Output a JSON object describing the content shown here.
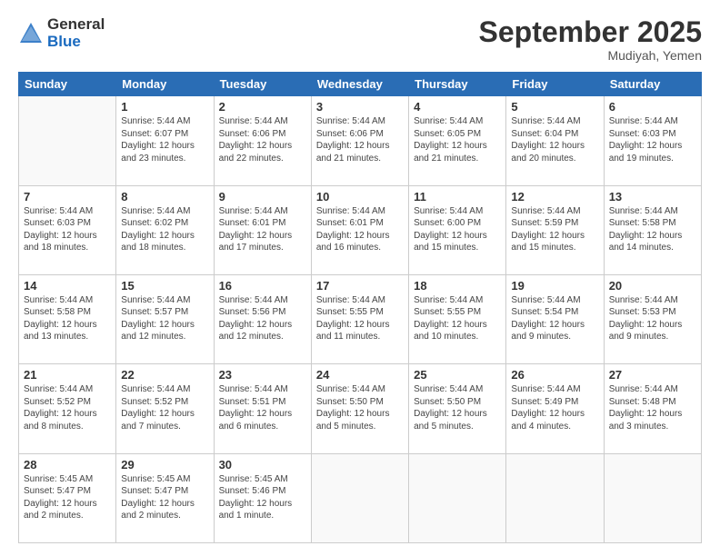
{
  "logo": {
    "general": "General",
    "blue": "Blue"
  },
  "header": {
    "month": "September 2025",
    "location": "Mudiyah, Yemen"
  },
  "weekdays": [
    "Sunday",
    "Monday",
    "Tuesday",
    "Wednesday",
    "Thursday",
    "Friday",
    "Saturday"
  ],
  "weeks": [
    [
      {
        "day": "",
        "info": ""
      },
      {
        "day": "1",
        "info": "Sunrise: 5:44 AM\nSunset: 6:07 PM\nDaylight: 12 hours\nand 23 minutes."
      },
      {
        "day": "2",
        "info": "Sunrise: 5:44 AM\nSunset: 6:06 PM\nDaylight: 12 hours\nand 22 minutes."
      },
      {
        "day": "3",
        "info": "Sunrise: 5:44 AM\nSunset: 6:06 PM\nDaylight: 12 hours\nand 21 minutes."
      },
      {
        "day": "4",
        "info": "Sunrise: 5:44 AM\nSunset: 6:05 PM\nDaylight: 12 hours\nand 21 minutes."
      },
      {
        "day": "5",
        "info": "Sunrise: 5:44 AM\nSunset: 6:04 PM\nDaylight: 12 hours\nand 20 minutes."
      },
      {
        "day": "6",
        "info": "Sunrise: 5:44 AM\nSunset: 6:03 PM\nDaylight: 12 hours\nand 19 minutes."
      }
    ],
    [
      {
        "day": "7",
        "info": "Sunrise: 5:44 AM\nSunset: 6:03 PM\nDaylight: 12 hours\nand 18 minutes."
      },
      {
        "day": "8",
        "info": "Sunrise: 5:44 AM\nSunset: 6:02 PM\nDaylight: 12 hours\nand 18 minutes."
      },
      {
        "day": "9",
        "info": "Sunrise: 5:44 AM\nSunset: 6:01 PM\nDaylight: 12 hours\nand 17 minutes."
      },
      {
        "day": "10",
        "info": "Sunrise: 5:44 AM\nSunset: 6:01 PM\nDaylight: 12 hours\nand 16 minutes."
      },
      {
        "day": "11",
        "info": "Sunrise: 5:44 AM\nSunset: 6:00 PM\nDaylight: 12 hours\nand 15 minutes."
      },
      {
        "day": "12",
        "info": "Sunrise: 5:44 AM\nSunset: 5:59 PM\nDaylight: 12 hours\nand 15 minutes."
      },
      {
        "day": "13",
        "info": "Sunrise: 5:44 AM\nSunset: 5:58 PM\nDaylight: 12 hours\nand 14 minutes."
      }
    ],
    [
      {
        "day": "14",
        "info": "Sunrise: 5:44 AM\nSunset: 5:58 PM\nDaylight: 12 hours\nand 13 minutes."
      },
      {
        "day": "15",
        "info": "Sunrise: 5:44 AM\nSunset: 5:57 PM\nDaylight: 12 hours\nand 12 minutes."
      },
      {
        "day": "16",
        "info": "Sunrise: 5:44 AM\nSunset: 5:56 PM\nDaylight: 12 hours\nand 12 minutes."
      },
      {
        "day": "17",
        "info": "Sunrise: 5:44 AM\nSunset: 5:55 PM\nDaylight: 12 hours\nand 11 minutes."
      },
      {
        "day": "18",
        "info": "Sunrise: 5:44 AM\nSunset: 5:55 PM\nDaylight: 12 hours\nand 10 minutes."
      },
      {
        "day": "19",
        "info": "Sunrise: 5:44 AM\nSunset: 5:54 PM\nDaylight: 12 hours\nand 9 minutes."
      },
      {
        "day": "20",
        "info": "Sunrise: 5:44 AM\nSunset: 5:53 PM\nDaylight: 12 hours\nand 9 minutes."
      }
    ],
    [
      {
        "day": "21",
        "info": "Sunrise: 5:44 AM\nSunset: 5:52 PM\nDaylight: 12 hours\nand 8 minutes."
      },
      {
        "day": "22",
        "info": "Sunrise: 5:44 AM\nSunset: 5:52 PM\nDaylight: 12 hours\nand 7 minutes."
      },
      {
        "day": "23",
        "info": "Sunrise: 5:44 AM\nSunset: 5:51 PM\nDaylight: 12 hours\nand 6 minutes."
      },
      {
        "day": "24",
        "info": "Sunrise: 5:44 AM\nSunset: 5:50 PM\nDaylight: 12 hours\nand 5 minutes."
      },
      {
        "day": "25",
        "info": "Sunrise: 5:44 AM\nSunset: 5:50 PM\nDaylight: 12 hours\nand 5 minutes."
      },
      {
        "day": "26",
        "info": "Sunrise: 5:44 AM\nSunset: 5:49 PM\nDaylight: 12 hours\nand 4 minutes."
      },
      {
        "day": "27",
        "info": "Sunrise: 5:44 AM\nSunset: 5:48 PM\nDaylight: 12 hours\nand 3 minutes."
      }
    ],
    [
      {
        "day": "28",
        "info": "Sunrise: 5:45 AM\nSunset: 5:47 PM\nDaylight: 12 hours\nand 2 minutes."
      },
      {
        "day": "29",
        "info": "Sunrise: 5:45 AM\nSunset: 5:47 PM\nDaylight: 12 hours\nand 2 minutes."
      },
      {
        "day": "30",
        "info": "Sunrise: 5:45 AM\nSunset: 5:46 PM\nDaylight: 12 hours\nand 1 minute."
      },
      {
        "day": "",
        "info": ""
      },
      {
        "day": "",
        "info": ""
      },
      {
        "day": "",
        "info": ""
      },
      {
        "day": "",
        "info": ""
      }
    ]
  ]
}
